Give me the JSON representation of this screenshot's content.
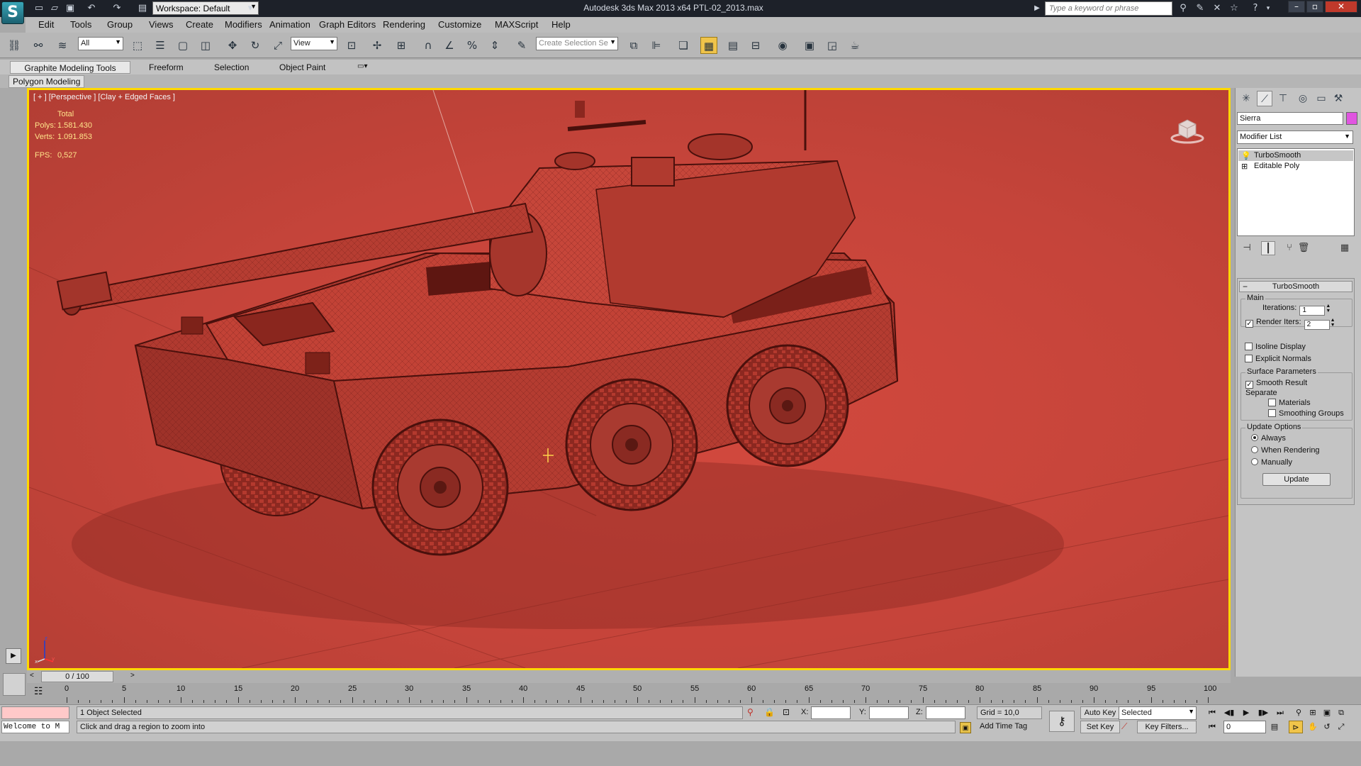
{
  "app": {
    "title": "Autodesk 3ds Max  2013 x64     PTL-02_2013.max",
    "logo_glyph": "S",
    "workspace": "Workspace: Default",
    "search_placeholder": "Type a keyword or phrase"
  },
  "menu": [
    "Edit",
    "Tools",
    "Group",
    "Views",
    "Create",
    "Modifiers",
    "Animation",
    "Graph Editors",
    "Rendering",
    "Customize",
    "MAXScript",
    "Help"
  ],
  "toolbar": {
    "filter": "All",
    "ref_coord": "View",
    "selection_set_placeholder": "Create Selection Se"
  },
  "ribbon": {
    "tabs": [
      "Graphite Modeling Tools",
      "Freeform",
      "Selection",
      "Object Paint"
    ],
    "sub_tab": "Polygon Modeling"
  },
  "viewport": {
    "label": "[ + ] [Perspective ] [Clay + Edged Faces ]",
    "stats_header": "Total",
    "polys_label": "Polys:",
    "polys_value": "1.581.430",
    "verts_label": "Verts:",
    "verts_value": "1.091.853",
    "fps_label": "FPS:",
    "fps_value": "0,527",
    "bg_color": "#c5443a"
  },
  "command_panel": {
    "object_name": "Sierra",
    "object_color": "#e055e0",
    "modifier_list": "Modifier List",
    "stack": [
      "TurboSmooth",
      "Editable Poly"
    ]
  },
  "turbosmooth": {
    "title": "TurboSmooth",
    "main_label": "Main",
    "iterations_label": "Iterations:",
    "iterations": "1",
    "render_iters_label": "Render Iters:",
    "render_iters": "2",
    "render_iters_checked": true,
    "isoline_label": "Isoline Display",
    "explicit_normals_label": "Explicit Normals",
    "surface_params_label": "Surface Parameters",
    "smooth_result_label": "Smooth Result",
    "separate_label": "Separate",
    "materials_label": "Materials",
    "smoothing_groups_label": "Smoothing Groups",
    "update_options_label": "Update Options",
    "always_label": "Always",
    "when_rendering_label": "When Rendering",
    "manually_label": "Manually",
    "update_button": "Update",
    "update_option_selected": "Always"
  },
  "timeline": {
    "slider": "0 / 100",
    "ticks": [
      0,
      5,
      10,
      15,
      20,
      25,
      30,
      35,
      40,
      45,
      50,
      55,
      60,
      65,
      70,
      75,
      80,
      85,
      90,
      95,
      100
    ]
  },
  "status": {
    "selection": "1 Object Selected",
    "prompt": "Click and drag a region to zoom into",
    "maxscript_listener": "Welcome to M",
    "x_label": "X:",
    "y_label": "Y:",
    "z_label": "Z:",
    "grid": "Grid = 10,0",
    "add_time_tag": "Add Time Tag",
    "auto_key": "Auto Key",
    "set_key": "Set Key",
    "key_mode": "Selected",
    "key_filters": "Key Filters...",
    "current_frame": "0"
  }
}
